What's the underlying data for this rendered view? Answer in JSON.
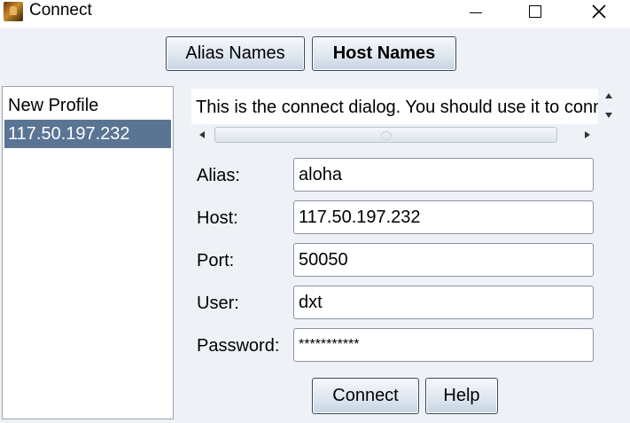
{
  "window": {
    "title": "Connect"
  },
  "tabs": {
    "alias_names": "Alias Names",
    "host_names": "Host Names"
  },
  "profiles": [
    {
      "label": "New Profile",
      "selected": false
    },
    {
      "label": "117.50.197.232",
      "selected": true
    }
  ],
  "info": {
    "text": "This is the connect dialog. You should use it to connect"
  },
  "form": {
    "alias": {
      "label": "Alias:",
      "value": "aloha"
    },
    "host": {
      "label": "Host:",
      "value": "117.50.197.232"
    },
    "port": {
      "label": "Port:",
      "value": "50050"
    },
    "user": {
      "label": "User:",
      "value": "dxt"
    },
    "password": {
      "label": "Password:",
      "value": "***********"
    }
  },
  "buttons": {
    "connect": "Connect",
    "help": "Help"
  },
  "colors": {
    "selection": "#5a7494",
    "client_bg": "#eef1f6"
  }
}
